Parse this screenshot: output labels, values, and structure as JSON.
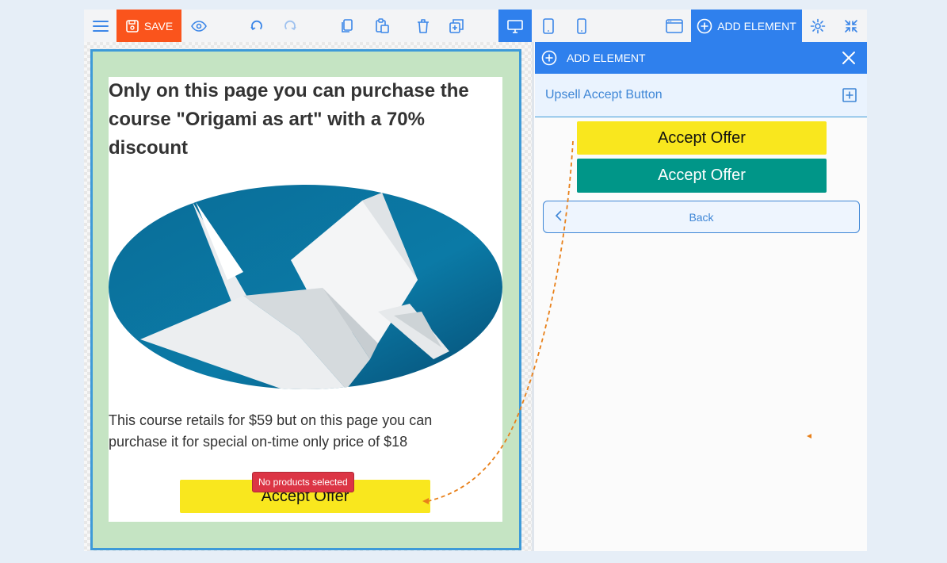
{
  "toolbar": {
    "save_label": "SAVE",
    "add_element_label": "ADD ELEMENT"
  },
  "canvas": {
    "headline": "Only on this page you can purchase the course \"Origami as art\" with a 70% discount",
    "body_text": "This course retails for $59 but on this page you can purchase it for special on-time only price of $18",
    "accept_button_label": "Accept Offer",
    "no_products_badge": "No products selected"
  },
  "panel": {
    "header_title": "ADD ELEMENT",
    "section_title": "Upsell Accept Button",
    "option_yellow_label": "Accept Offer",
    "option_teal_label": "Accept Offer",
    "back_label": "Back"
  },
  "colors": {
    "save": "#fa541c",
    "accent": "#2f80ed",
    "button_yellow": "#f9e71e",
    "button_teal": "#009688",
    "badge_red": "#dc3545",
    "frame_green": "#c5e4c3",
    "drag_path": "#e8801a"
  }
}
